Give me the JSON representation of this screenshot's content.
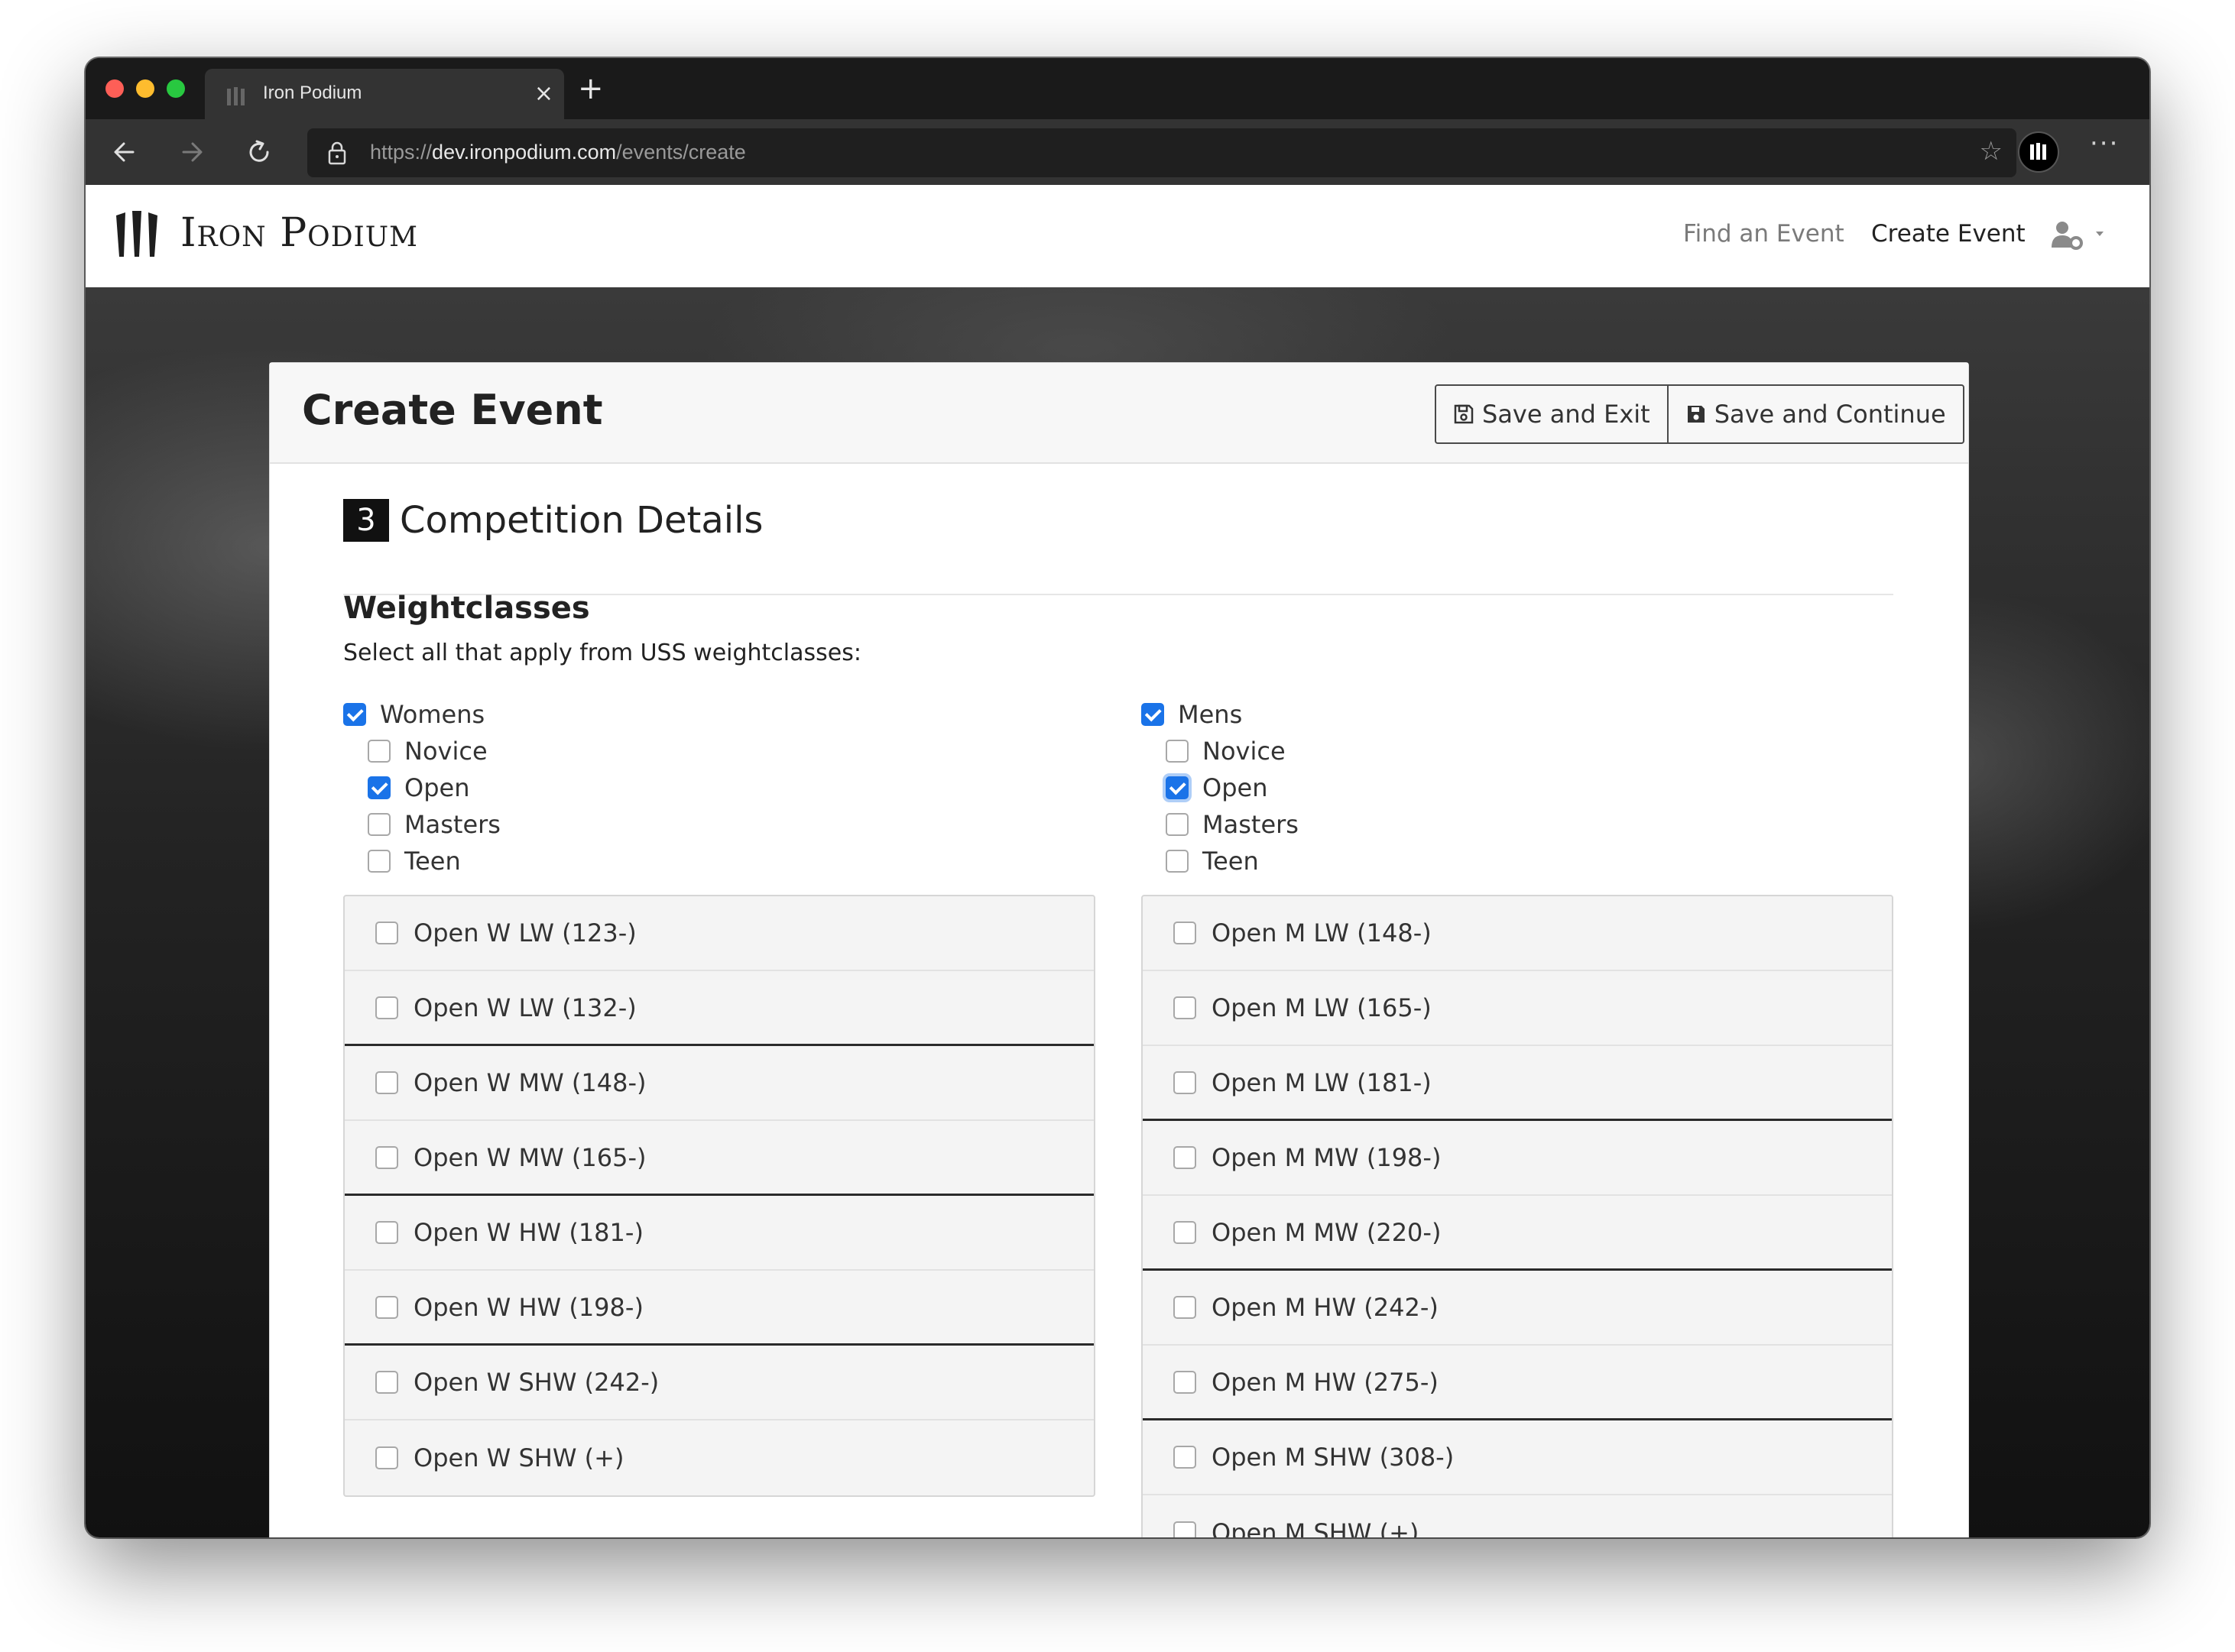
{
  "browser": {
    "tab_title": "Iron Podium",
    "url_prefix": "https://",
    "url_host": "dev.ironpodium.com",
    "url_path": "/events/create"
  },
  "navbar": {
    "brand": "Iron Podium",
    "find_event": "Find an Event",
    "create_event": "Create Event"
  },
  "card": {
    "title": "Create Event",
    "save_exit": "Save and Exit",
    "save_continue": "Save and Continue"
  },
  "section": {
    "number": "3",
    "title": "Competition Details",
    "subtitle": "Weightclasses",
    "hint": "Select all that apply from USS weightclasses:"
  },
  "womens": {
    "label": "Womens",
    "checked": true,
    "divisions": [
      {
        "label": "Novice",
        "checked": false
      },
      {
        "label": "Open",
        "checked": true
      },
      {
        "label": "Masters",
        "checked": false
      },
      {
        "label": "Teen",
        "checked": false
      }
    ],
    "classes": [
      {
        "label": "Open W LW (123-)",
        "checked": false
      },
      {
        "label": "Open W LW (132-)",
        "checked": false
      },
      {
        "label": "Open W MW (148-)",
        "checked": false
      },
      {
        "label": "Open W MW (165-)",
        "checked": false
      },
      {
        "label": "Open W HW (181-)",
        "checked": false
      },
      {
        "label": "Open W HW (198-)",
        "checked": false
      },
      {
        "label": "Open W SHW (242-)",
        "checked": false
      },
      {
        "label": "Open W SHW (+)",
        "checked": false
      }
    ]
  },
  "mens": {
    "label": "Mens",
    "checked": true,
    "divisions": [
      {
        "label": "Novice",
        "checked": false
      },
      {
        "label": "Open",
        "checked": true
      },
      {
        "label": "Masters",
        "checked": false
      },
      {
        "label": "Teen",
        "checked": false
      }
    ],
    "classes": [
      {
        "label": "Open M LW (148-)",
        "checked": false
      },
      {
        "label": "Open M LW (165-)",
        "checked": false
      },
      {
        "label": "Open M LW (181-)",
        "checked": false
      },
      {
        "label": "Open M MW (198-)",
        "checked": false
      },
      {
        "label": "Open M MW (220-)",
        "checked": false
      },
      {
        "label": "Open M HW (242-)",
        "checked": false
      },
      {
        "label": "Open M HW (275-)",
        "checked": false
      },
      {
        "label": "Open M SHW (308-)",
        "checked": false
      },
      {
        "label": "Open M SHW (+)",
        "checked": false
      }
    ]
  },
  "colors": {
    "accent": "#1a73e8",
    "traffic_red": "#fe5f57",
    "traffic_yellow": "#febc2e",
    "traffic_green": "#28c840"
  }
}
